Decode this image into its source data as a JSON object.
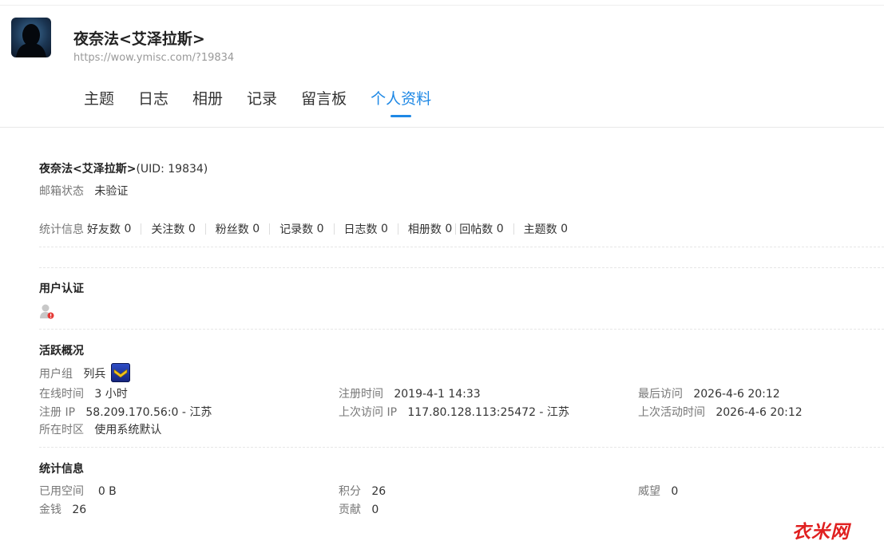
{
  "profile": {
    "name": "夜奈法<艾泽拉斯>",
    "url": "https://wow.ymisc.com/?19834"
  },
  "tabs": [
    {
      "label": "主题"
    },
    {
      "label": "日志"
    },
    {
      "label": "相册"
    },
    {
      "label": "记录"
    },
    {
      "label": "留言板"
    },
    {
      "label": "个人资料",
      "active": true
    }
  ],
  "info": {
    "name": "夜奈法<艾泽拉斯>",
    "uid": "(UID: 19834)",
    "email_label": "邮箱状态",
    "email_value": "未验证"
  },
  "stats": {
    "label": "统计信息",
    "items": [
      {
        "label": "好友数",
        "value": "0"
      },
      {
        "label": "关注数",
        "value": "0"
      },
      {
        "label": "粉丝数",
        "value": "0"
      },
      {
        "label": "记录数",
        "value": "0"
      },
      {
        "label": "日志数",
        "value": "0"
      },
      {
        "label": "相册数",
        "value": "0"
      },
      {
        "label": "回帖数",
        "value": "0"
      },
      {
        "label": "主题数",
        "value": "0"
      }
    ]
  },
  "verification": {
    "title": "用户认证",
    "icon": "user-unverified-icon"
  },
  "activity": {
    "title": "活跃概况",
    "usergroup_label": "用户组",
    "usergroup_value": "列兵",
    "badge_icon": "rank-badge-icon",
    "online_label": "在线时间",
    "online_value": "3 小时",
    "register_time_label": "注册时间",
    "register_time_value": "2019-4-1 14:33",
    "last_visit_label": "最后访问",
    "last_visit_value": "2026-4-6 20:12",
    "register_ip_label": "注册 IP",
    "register_ip_value": "58.209.170.56:0 - 江苏",
    "last_visit_ip_label": "上次访问 IP",
    "last_visit_ip_value": "117.80.128.113:25472 - 江苏",
    "last_active_label": "上次活动时间",
    "last_active_value": "2026-4-6 20:12",
    "timezone_label": "所在时区",
    "timezone_value": "使用系统默认"
  },
  "statistics": {
    "title": "统计信息",
    "space_label": "已用空间",
    "space_value": "0 B",
    "credits_label": "积分",
    "credits_value": "26",
    "prestige_label": "威望",
    "prestige_value": "0",
    "money_label": "金钱",
    "money_value": "26",
    "contribution_label": "贡献",
    "contribution_value": "0"
  },
  "watermark": "衣米网",
  "colors": {
    "accent": "#1e88e5",
    "watermark": "#e02020",
    "badge": "#2f4fc9"
  }
}
